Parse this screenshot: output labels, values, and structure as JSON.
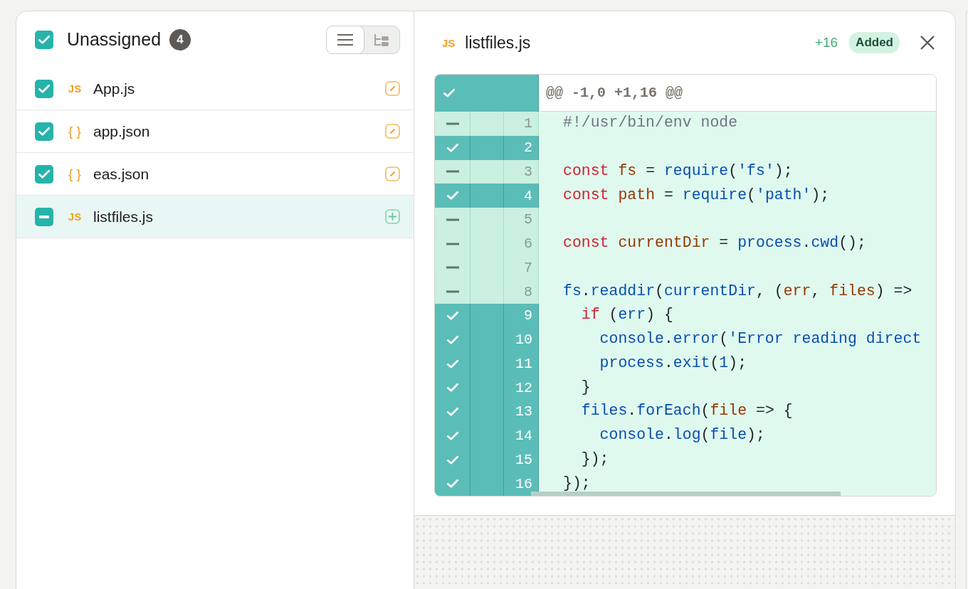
{
  "group": {
    "title": "Unassigned",
    "count": "4",
    "checked": true
  },
  "view_toggle": [
    {
      "kind": "list",
      "selected": true
    },
    {
      "kind": "tree",
      "selected": false
    }
  ],
  "files": [
    {
      "name": "App.js",
      "badge": "JS",
      "checked": true,
      "kind": "modified",
      "selected": false
    },
    {
      "name": "app.json",
      "badge": "{ }",
      "checked": true,
      "kind": "modified",
      "selected": false
    },
    {
      "name": "eas.json",
      "badge": "{ }",
      "checked": true,
      "kind": "modified",
      "selected": false
    },
    {
      "name": "listfiles.js",
      "badge": "JS",
      "checked": true,
      "indeterminate": true,
      "kind": "added",
      "selected": true
    }
  ],
  "diff": {
    "badge": "JS",
    "file": "listfiles.js",
    "additions": "+16",
    "status": "Added",
    "hunk": {
      "header": "@@ -1,0 +1,16 @@",
      "selected": true
    },
    "lines": [
      {
        "number": "1",
        "selected": false,
        "tokens": [
          {
            "text": "#!/usr/bin/env node",
            "kind": "comment"
          }
        ]
      },
      {
        "number": "2",
        "selected": true
      },
      {
        "number": "3",
        "selected": false,
        "tokens": [
          {
            "text": "const ",
            "kind": "keyword"
          },
          {
            "text": "fs",
            "kind": "name"
          },
          {
            "text": " = ",
            "kind": "plain"
          },
          {
            "text": "require",
            "kind": "call"
          },
          {
            "text": "(",
            "kind": "plain"
          },
          {
            "text": "'fs'",
            "kind": "call"
          },
          {
            "text": ");",
            "kind": "plain"
          }
        ]
      },
      {
        "number": "4",
        "selected": true,
        "tokens": [
          {
            "text": "const ",
            "kind": "keyword"
          },
          {
            "text": "path",
            "kind": "name"
          },
          {
            "text": " = ",
            "kind": "plain"
          },
          {
            "text": "require",
            "kind": "call"
          },
          {
            "text": "(",
            "kind": "plain"
          },
          {
            "text": "'path'",
            "kind": "call"
          },
          {
            "text": ");",
            "kind": "plain"
          }
        ]
      },
      {
        "number": "5",
        "selected": false
      },
      {
        "number": "6",
        "selected": false,
        "tokens": [
          {
            "text": "const ",
            "kind": "keyword"
          },
          {
            "text": "currentDir",
            "kind": "name"
          },
          {
            "text": " = ",
            "kind": "plain"
          },
          {
            "text": "process",
            "kind": "call"
          },
          {
            "text": ".",
            "kind": "plain"
          },
          {
            "text": "cwd",
            "kind": "call"
          },
          {
            "text": "();",
            "kind": "plain"
          }
        ]
      },
      {
        "number": "7",
        "selected": false
      },
      {
        "number": "8",
        "selected": false,
        "tokens": [
          {
            "text": "fs",
            "kind": "call"
          },
          {
            "text": ".",
            "kind": "plain"
          },
          {
            "text": "readdir",
            "kind": "call"
          },
          {
            "text": "(",
            "kind": "plain"
          },
          {
            "text": "currentDir",
            "kind": "call"
          },
          {
            "text": ", (",
            "kind": "plain"
          },
          {
            "text": "err",
            "kind": "name"
          },
          {
            "text": ", ",
            "kind": "plain"
          },
          {
            "text": "files",
            "kind": "name"
          },
          {
            "text": ") =>",
            "kind": "plain"
          }
        ]
      },
      {
        "number": "9",
        "selected": true,
        "tokens": [
          {
            "text": "  if",
            "kind": "keyword"
          },
          {
            "text": " (",
            "kind": "plain"
          },
          {
            "text": "err",
            "kind": "call"
          },
          {
            "text": ") {",
            "kind": "plain"
          }
        ]
      },
      {
        "number": "10",
        "selected": true,
        "tokens": [
          {
            "text": "    console",
            "kind": "call"
          },
          {
            "text": ".",
            "kind": "plain"
          },
          {
            "text": "error",
            "kind": "call"
          },
          {
            "text": "(",
            "kind": "plain"
          },
          {
            "text": "'Error reading direct",
            "kind": "call"
          }
        ]
      },
      {
        "number": "11",
        "selected": true,
        "tokens": [
          {
            "text": "    process",
            "kind": "call"
          },
          {
            "text": ".",
            "kind": "plain"
          },
          {
            "text": "exit",
            "kind": "call"
          },
          {
            "text": "(",
            "kind": "plain"
          },
          {
            "text": "1",
            "kind": "call"
          },
          {
            "text": ");",
            "kind": "plain"
          }
        ]
      },
      {
        "number": "12",
        "selected": true,
        "tokens": [
          {
            "text": "  }",
            "kind": "plain"
          }
        ]
      },
      {
        "number": "13",
        "selected": true,
        "tokens": [
          {
            "text": "  files",
            "kind": "call"
          },
          {
            "text": ".",
            "kind": "plain"
          },
          {
            "text": "forEach",
            "kind": "call"
          },
          {
            "text": "(",
            "kind": "plain"
          },
          {
            "text": "file",
            "kind": "name"
          },
          {
            "text": " => {",
            "kind": "plain"
          }
        ]
      },
      {
        "number": "14",
        "selected": true,
        "tokens": [
          {
            "text": "    console",
            "kind": "call"
          },
          {
            "text": ".",
            "kind": "plain"
          },
          {
            "text": "log",
            "kind": "call"
          },
          {
            "text": "(",
            "kind": "plain"
          },
          {
            "text": "file",
            "kind": "call"
          },
          {
            "text": ");",
            "kind": "plain"
          }
        ]
      },
      {
        "number": "15",
        "selected": true,
        "tokens": [
          {
            "text": "  });",
            "kind": "plain"
          }
        ]
      },
      {
        "number": "16",
        "selected": true,
        "tokens": [
          {
            "text": "});",
            "kind": "plain"
          }
        ]
      }
    ]
  }
}
